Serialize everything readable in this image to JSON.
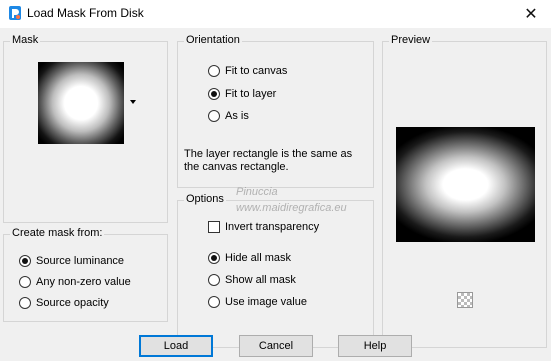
{
  "window": {
    "title": "Load Mask From Disk",
    "close_glyph": "✕",
    "watermark_1": "Pinuccia",
    "watermark_2": "www.maidiregrafica.eu"
  },
  "mask": {
    "label": "Mask"
  },
  "create_from": {
    "label": "Create mask from:",
    "options": [
      {
        "label": "Source luminance",
        "checked": true
      },
      {
        "label": "Any non-zero value",
        "checked": false
      },
      {
        "label": "Source opacity",
        "checked": false
      }
    ]
  },
  "orientation": {
    "label": "Orientation",
    "options": [
      {
        "label": "Fit to canvas",
        "checked": false
      },
      {
        "label": "Fit to layer",
        "checked": true
      },
      {
        "label": "As is",
        "checked": false
      }
    ],
    "note": "The layer rectangle is the same as the canvas rectangle."
  },
  "options": {
    "label": "Options",
    "invert_label": "Invert transparency",
    "invert_checked": false,
    "show": [
      {
        "label": "Hide all mask",
        "checked": true
      },
      {
        "label": "Show all mask",
        "checked": false
      },
      {
        "label": "Use image value",
        "checked": false
      }
    ]
  },
  "preview": {
    "label": "Preview"
  },
  "buttons": {
    "load": "Load",
    "cancel": "Cancel",
    "help": "Help"
  },
  "colors": {
    "accent": "#0078d7",
    "dialog_bg": "#f0f0f0"
  },
  "icons": {
    "app": "paint-shop-pro-icon",
    "close": "close-icon",
    "dropdown": "chevron-down-icon",
    "transparency": "checkerboard-icon"
  }
}
